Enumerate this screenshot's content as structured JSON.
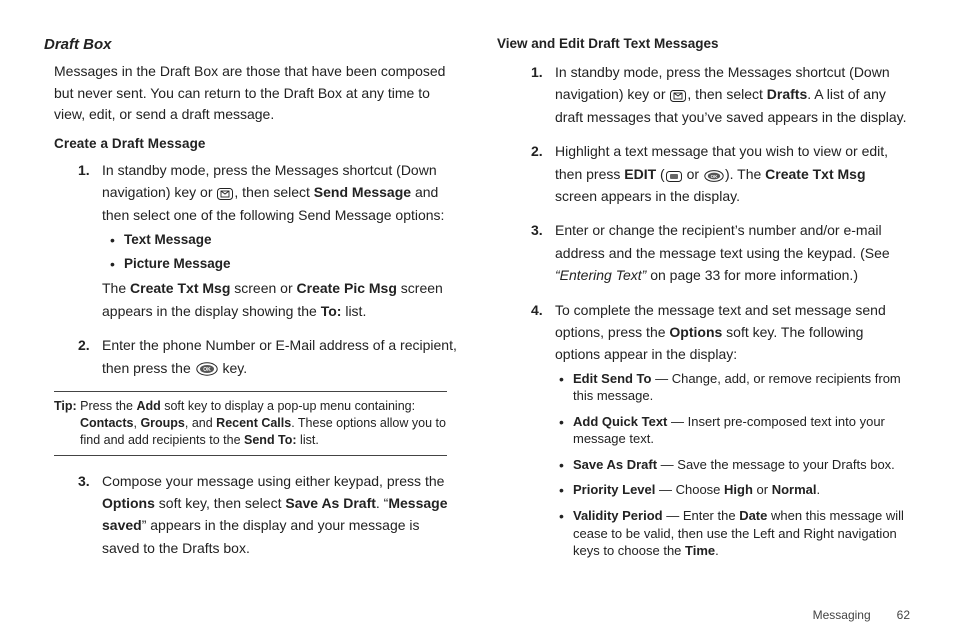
{
  "left": {
    "section_title": "Draft Box",
    "intro": "Messages in the Draft Box are those that have been composed but never sent. You can return to the Draft Box at any time to view, edit, or send a draft message.",
    "sub_heading": "Create a Draft Message",
    "step1": {
      "num": "1.",
      "frag1": "In standby mode, press the Messages shortcut (Down navigation) key or ",
      "frag2": ", then select ",
      "bold1": "Send Message",
      "frag3": " and then select one of the following Send Message options:",
      "b1": "Text Message",
      "b2": "Picture Message",
      "after_frag1": "The ",
      "after_bold1": "Create Txt Msg",
      "after_frag2": " screen or ",
      "after_bold2": "Create Pic Msg",
      "after_frag3": " screen appears in the display showing the ",
      "after_bold3": "To:",
      "after_frag4": " list."
    },
    "step2": {
      "num": "2.",
      "frag1": "Enter the phone Number or E-Mail address of a recipient, then press the ",
      "frag2": " key."
    },
    "tip": {
      "label": "Tip:",
      "frag1": " Press the ",
      "b1": "Add",
      "frag2": " soft key to display a pop-up menu containing: ",
      "b2": "Contacts",
      "frag3": ", ",
      "b3": "Groups",
      "frag4": ", and ",
      "b4": "Recent Calls",
      "frag5": ". These options allow you to find and add recipients to the ",
      "b5": "Send To:",
      "frag6": " list."
    },
    "step3": {
      "num": "3.",
      "frag1": "Compose your message using either keypad, press the ",
      "b1": "Options",
      "frag2": " soft key, then select ",
      "b2": "Save As Draft",
      "frag3": ". “",
      "b3": "Message saved",
      "frag4": "” appears in the display and your message is saved to the Drafts box."
    }
  },
  "right": {
    "sub_heading": "View and Edit Draft Text Messages",
    "step1": {
      "num": "1.",
      "frag1": "In standby mode, press the Messages shortcut (Down navigation) key or ",
      "frag2": ", then select ",
      "b1": "Drafts",
      "frag3": ". A list of any draft messages that you’ve saved appears in the display."
    },
    "step2": {
      "num": "2.",
      "frag1": "Highlight a text message that you wish to view or edit, then press ",
      "b1": "EDIT",
      "frag2": " (",
      "frag3": " or ",
      "frag4": "). The ",
      "b2": "Create Txt Msg",
      "frag5": " screen appears in the display."
    },
    "step3": {
      "num": "3.",
      "frag1": "Enter or change the recipient’s number and/or e-mail address and the message text using the keypad. (See ",
      "i1": "“Entering Text”",
      "frag2": " on page 33 for more information.)"
    },
    "step4": {
      "num": "4.",
      "frag1": "To complete the message text and set message send options, press the ",
      "b1": "Options",
      "frag2": " soft key. The following options appear in the display:"
    },
    "opts": {
      "o1": {
        "b": "Edit Send To",
        "t": " — Change, add, or remove recipients from this message."
      },
      "o2": {
        "b": "Add Quick Text",
        "t": " — Insert pre-composed text into your message text."
      },
      "o3": {
        "b": "Save As Draft",
        "t": " — Save the message to your Drafts box."
      },
      "o4": {
        "b": "Priority Level",
        "t1": " — Choose ",
        "b2": "High",
        "t2": " or ",
        "b3": "Normal",
        "t3": "."
      },
      "o5": {
        "b": "Validity Period",
        "t1": " — Enter the ",
        "b2": "Date",
        "t2": " when this message will cease to be valid, then use the Left and Right navigation keys to choose the ",
        "b3": "Time",
        "t3": "."
      }
    }
  },
  "footer": {
    "section": "Messaging",
    "page": "62"
  }
}
